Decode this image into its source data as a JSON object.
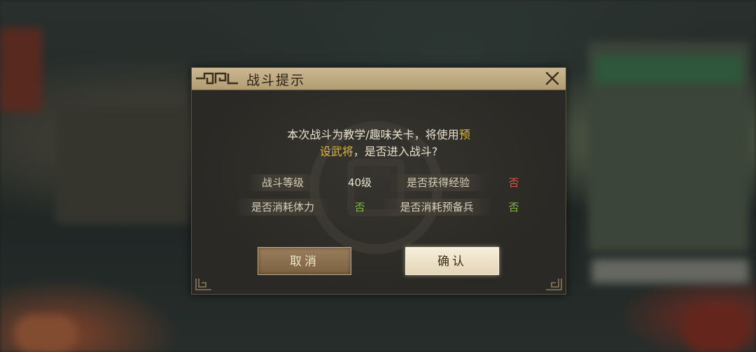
{
  "dialog": {
    "title": "战斗提示",
    "message_part1": "本次战斗为教学/趣味关卡，将使用",
    "message_highlight_a": "预",
    "message_highlight_b": "设武将",
    "message_part2": "，是否进入战斗?",
    "rows": [
      {
        "label": "战斗等级",
        "value": "40级",
        "value_color": "white"
      },
      {
        "label": "是否获得经验",
        "value": "否",
        "value_color": "red"
      },
      {
        "label": "是否消耗体力",
        "value": "否",
        "value_color": "green"
      },
      {
        "label": "是否消耗预备兵",
        "value": "否",
        "value_color": "green"
      }
    ],
    "cancel_label": "取消",
    "confirm_label": "确认"
  },
  "colors": {
    "highlight": "#e3b73b",
    "no_red": "#d8553f",
    "no_green": "#7ebc3f"
  },
  "icons": {
    "close": "close-icon",
    "title_ornament": "ornament-icon",
    "corner": "corner-ornament-icon"
  }
}
